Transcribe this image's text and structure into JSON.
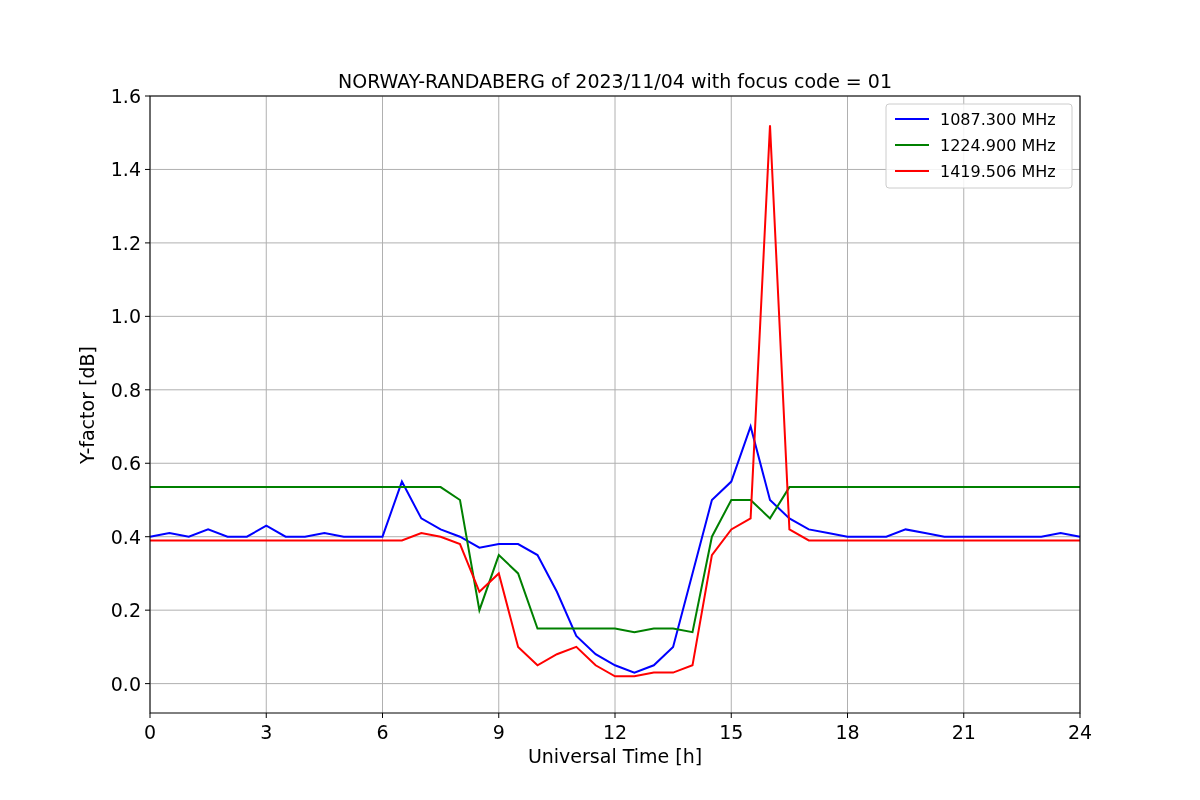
{
  "chart_data": {
    "type": "line",
    "title": "NORWAY-RANDABERG of 2023/11/04 with focus code = 01",
    "xlabel": "Universal Time [h]",
    "ylabel": "Y-factor [dB]",
    "x": [
      0,
      0.5,
      1,
      1.5,
      2,
      2.5,
      3,
      3.5,
      4,
      4.5,
      5,
      5.5,
      6,
      6.5,
      7,
      7.5,
      8,
      8.5,
      9,
      9.5,
      10,
      10.5,
      11,
      11.5,
      12,
      12.5,
      13,
      13.5,
      14,
      14.5,
      15,
      15.5,
      16,
      16.5,
      17,
      17.5,
      18,
      18.5,
      19,
      19.5,
      20,
      20.5,
      21,
      21.5,
      22,
      22.5,
      23,
      23.5,
      24
    ],
    "series": [
      {
        "name": "1087.300 MHz",
        "color": "#0000ff",
        "values": [
          0.4,
          0.41,
          0.4,
          0.42,
          0.4,
          0.4,
          0.43,
          0.4,
          0.4,
          0.41,
          0.4,
          0.4,
          0.4,
          0.55,
          0.45,
          0.42,
          0.4,
          0.37,
          0.38,
          0.38,
          0.35,
          0.25,
          0.13,
          0.08,
          0.05,
          0.03,
          0.05,
          0.1,
          0.3,
          0.5,
          0.55,
          0.7,
          0.5,
          0.45,
          0.42,
          0.41,
          0.4,
          0.4,
          0.4,
          0.42,
          0.41,
          0.4,
          0.4,
          0.4,
          0.4,
          0.4,
          0.4,
          0.41,
          0.4
        ]
      },
      {
        "name": "1224.900 MHz",
        "color": "#008000",
        "values": [
          0.535,
          0.535,
          0.535,
          0.535,
          0.535,
          0.535,
          0.535,
          0.535,
          0.535,
          0.535,
          0.535,
          0.535,
          0.535,
          0.535,
          0.535,
          0.535,
          0.5,
          0.2,
          0.35,
          0.3,
          0.15,
          0.15,
          0.15,
          0.15,
          0.15,
          0.14,
          0.15,
          0.15,
          0.14,
          0.4,
          0.5,
          0.5,
          0.45,
          0.535,
          0.535,
          0.535,
          0.535,
          0.535,
          0.535,
          0.535,
          0.535,
          0.535,
          0.535,
          0.535,
          0.535,
          0.535,
          0.535,
          0.535,
          0.535
        ]
      },
      {
        "name": "1419.506 MHz",
        "color": "#ff0000",
        "values": [
          0.39,
          0.39,
          0.39,
          0.39,
          0.39,
          0.39,
          0.39,
          0.39,
          0.39,
          0.39,
          0.39,
          0.39,
          0.39,
          0.39,
          0.41,
          0.4,
          0.38,
          0.25,
          0.3,
          0.1,
          0.05,
          0.08,
          0.1,
          0.05,
          0.02,
          0.02,
          0.03,
          0.03,
          0.05,
          0.35,
          0.42,
          0.45,
          1.52,
          0.42,
          0.39,
          0.39,
          0.39,
          0.39,
          0.39,
          0.39,
          0.39,
          0.39,
          0.39,
          0.39,
          0.39,
          0.39,
          0.39,
          0.39,
          0.39
        ]
      }
    ],
    "grid": true,
    "legend": true,
    "xlim": [
      0,
      24
    ],
    "ylim": [
      -0.08,
      1.6
    ],
    "xticks": [
      0,
      3,
      6,
      9,
      12,
      15,
      18,
      21,
      24
    ],
    "yticks": [
      {
        "value": 0,
        "label": "0.0"
      },
      {
        "value": 0.2,
        "label": "0.2"
      },
      {
        "value": 0.4,
        "label": "0.4"
      },
      {
        "value": 0.6,
        "label": "0.6"
      },
      {
        "value": 0.8,
        "label": "0.8"
      },
      {
        "value": 1.0,
        "label": "1.0"
      },
      {
        "value": 1.2,
        "label": "1.2"
      },
      {
        "value": 1.4,
        "label": "1.4"
      },
      {
        "value": 1.6,
        "label": "1.6"
      }
    ]
  }
}
